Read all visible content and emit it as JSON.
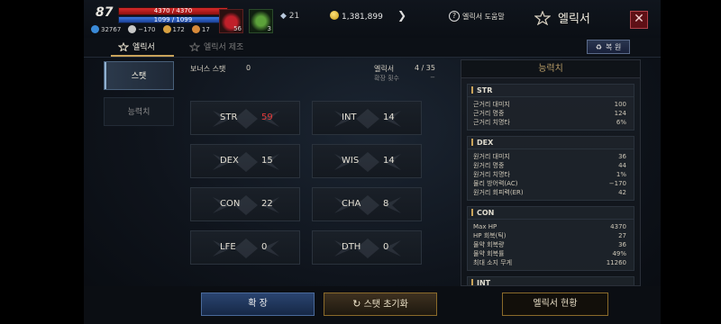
{
  "player": {
    "level": "87",
    "hp": "4370 / 4370",
    "mp": "1099 / 1099",
    "ac": "32767",
    "stat_a": "−170",
    "stat_b": "172",
    "stat_c": "17"
  },
  "inventory": {
    "slot1_count": "56",
    "slot2_count": "3",
    "diamonds": "21",
    "adena": "1,381,899"
  },
  "header": {
    "help_label": "엘릭서 도움말",
    "title": "엘릭서",
    "close_glyph": "✕"
  },
  "tabs": {
    "active": "엘릭서",
    "inactive": "엘릭서 제조",
    "restore_label": "복 원"
  },
  "leftnav": {
    "items": [
      "스탯",
      "능력치"
    ]
  },
  "summary": {
    "bonus_label": "보너스 스탯",
    "bonus_value": "0",
    "elixir_label": "엘릭서",
    "elixir_value": "4 / 35",
    "expand_label": "확장 횟수",
    "expand_value": "−"
  },
  "stats": [
    {
      "name": "STR",
      "value": "59",
      "highlight": true
    },
    {
      "name": "INT",
      "value": "14"
    },
    {
      "name": "DEX",
      "value": "15"
    },
    {
      "name": "WIS",
      "value": "14"
    },
    {
      "name": "CON",
      "value": "22"
    },
    {
      "name": "CHA",
      "value": "8"
    },
    {
      "name": "LFE",
      "value": "0"
    },
    {
      "name": "DTH",
      "value": "0"
    }
  ],
  "abilities": {
    "title": "능력치",
    "groups": [
      {
        "name": "STR",
        "rows": [
          [
            "근거리 대미지",
            "100"
          ],
          [
            "근거리 명중",
            "124"
          ],
          [
            "근거리 치명타",
            "6%"
          ]
        ]
      },
      {
        "name": "DEX",
        "rows": [
          [
            "원거리 대미지",
            "36"
          ],
          [
            "원거리 명중",
            "44"
          ],
          [
            "원거리 치명타",
            "1%"
          ],
          [
            "물리 방어력(AC)",
            "−170"
          ],
          [
            "원거리 회피력(ER)",
            "42"
          ]
        ]
      },
      {
        "name": "CON",
        "rows": [
          [
            "Max HP",
            "4370"
          ],
          [
            "HP 회복(틱)",
            "27"
          ],
          [
            "물약 회복량",
            "36"
          ],
          [
            "물약 회복률",
            "49%"
          ],
          [
            "최대 소지 무게",
            "11260"
          ]
        ]
      },
      {
        "name": "INT",
        "rows": []
      }
    ]
  },
  "buttons": {
    "expand": "확 장",
    "reset": "스탯 초기화",
    "status": "엘릭서 현황"
  },
  "colors": {
    "accent_gold": "#c9a35a",
    "highlight_red": "#e03a3a",
    "close_red": "#5e1016"
  }
}
